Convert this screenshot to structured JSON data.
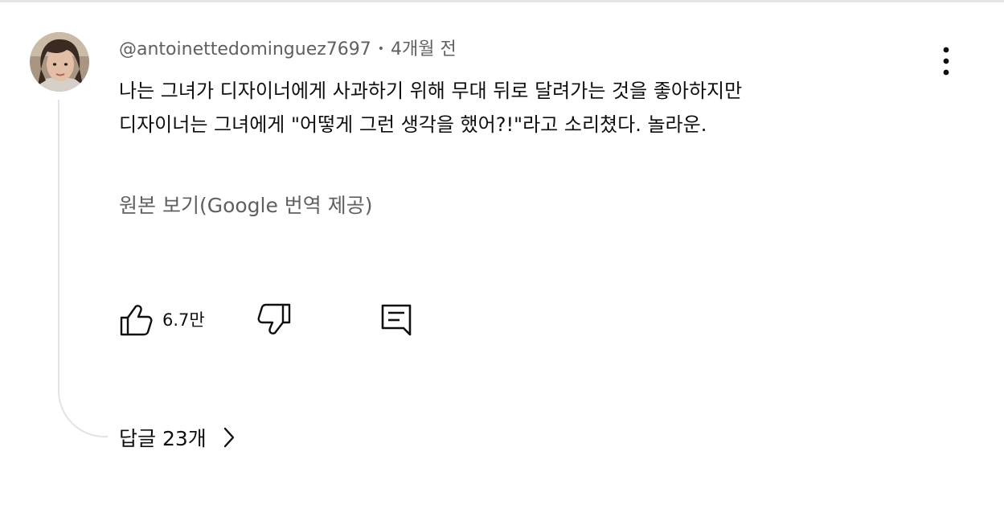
{
  "comment": {
    "author": "@antoinettedominguez7697",
    "separator": "•",
    "time": "4개월 전",
    "text_lines": [
      "나는 그녀가 디자이너에게 사과하기 위해 무대 뒤로 달려가는 것을 좋아하지만",
      "디자이너는 그녀에게 \"어떻게 그런 생각을 했어?!\"라고 소리쳤다. 놀라운."
    ],
    "see_original_label": "원본 보기(Google 번역 제공)",
    "avatar_icon": "user-avatar-photo"
  },
  "actions": {
    "like_icon": "thumbs-up-icon",
    "like_count": "6.7만",
    "dislike_icon": "thumbs-down-icon",
    "reply_icon": "comment-reply-icon",
    "more_icon": "more-vert-icon"
  },
  "replies": {
    "label": "답글 23개",
    "icon": "chevron-right-icon"
  },
  "colors": {
    "primary_text": "#0f0f0f",
    "secondary_text": "#606060",
    "thread_line": "#e3e3e3"
  }
}
